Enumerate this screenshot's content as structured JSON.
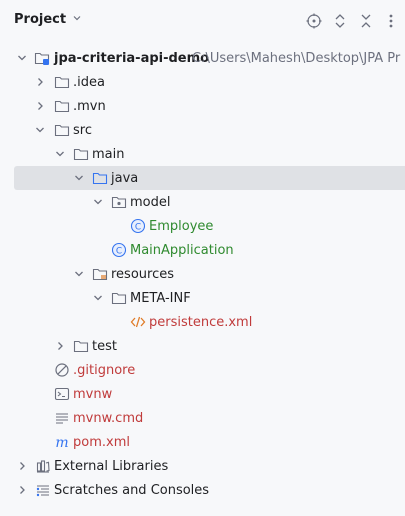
{
  "panel": {
    "title": "Project",
    "title_dropdown_icon": "chevron-down-icon",
    "toolbar_icons": [
      "crosshair-icon",
      "expand-collapse-icon",
      "collapse-all-icon",
      "more-vertical-icon"
    ]
  },
  "tree": {
    "root": {
      "name": "jpa-criteria-api-demo",
      "path": "C:\\Users\\Mahesh\\Desktop\\JPA Pr"
    },
    "idea": ".idea",
    "mvn": ".mvn",
    "src": "src",
    "main": "main",
    "java": "java",
    "model": "model",
    "employee": "Employee",
    "main_application": "MainApplication",
    "resources": "resources",
    "meta_inf": "META-INF",
    "persistence": "persistence.xml",
    "test": "test",
    "gitignore": ".gitignore",
    "mvnw": "mvnw",
    "mvnw_cmd": "mvnw.cmd",
    "pom": "pom.xml",
    "external_libraries": "External Libraries",
    "scratches": "Scratches and Consoles"
  },
  "colors": {
    "background": "#f7f8fa",
    "selection": "#dfe1e5",
    "class_green": "#2f8a2f",
    "unversioned_red": "#c03b3b",
    "accent_blue": "#3574f0"
  }
}
